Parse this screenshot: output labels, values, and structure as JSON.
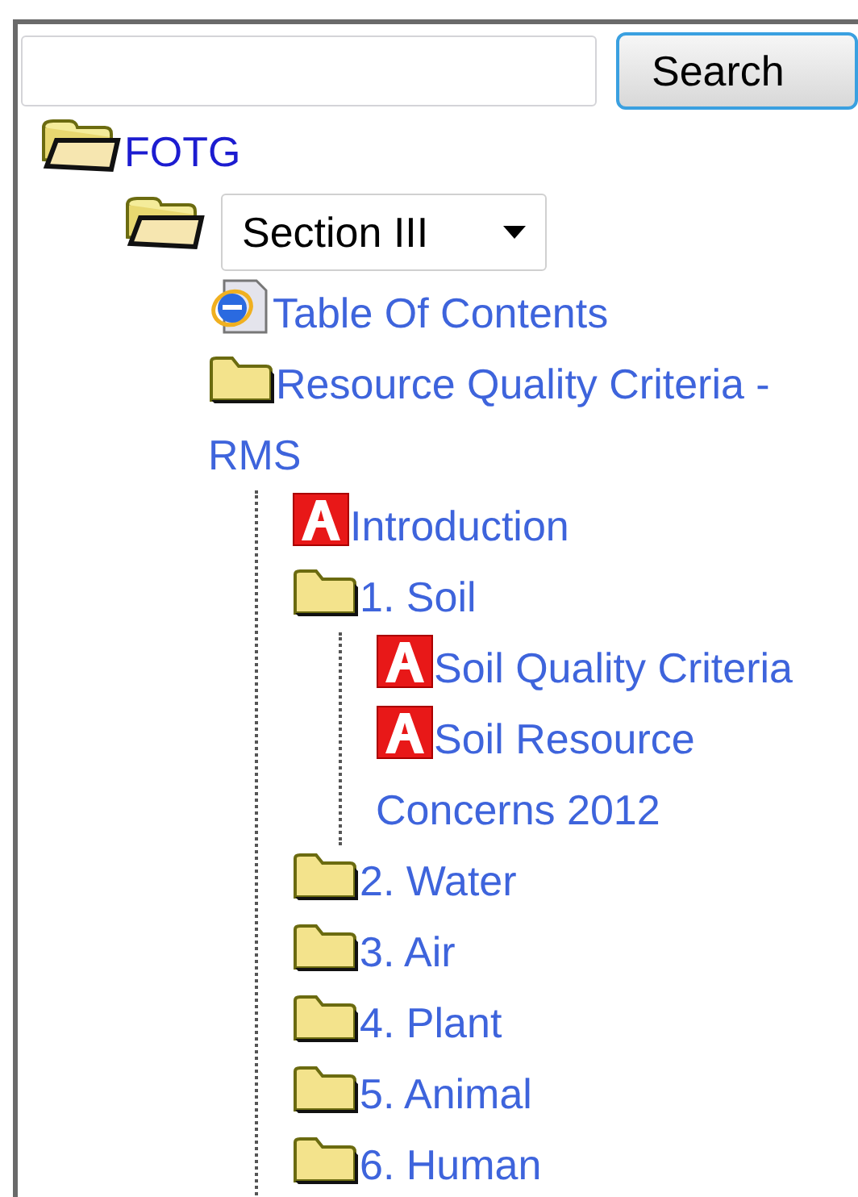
{
  "search": {
    "button": "Search"
  },
  "tree": [
    {
      "kind": "folder",
      "label": "FOTG",
      "expanded": true,
      "children": [
        {
          "kind": "select",
          "value": "Section III",
          "expanded": true,
          "children": [
            {
              "kind": "page",
              "label": "Table Of Contents"
            },
            {
              "kind": "folder",
              "label": "Resource Quality Criteria - RMS",
              "expanded": false,
              "children": [
                {
                  "kind": "pdf",
                  "label": "Introduction"
                },
                {
                  "kind": "folder",
                  "label": "1. Soil",
                  "expanded": false,
                  "children": [
                    {
                      "kind": "pdf",
                      "label": "Soil Quality Criteria"
                    },
                    {
                      "kind": "pdf",
                      "label": "Soil Resource Concerns 2012"
                    }
                  ]
                },
                {
                  "kind": "folder",
                  "label": "2. Water",
                  "expanded": false
                },
                {
                  "kind": "folder",
                  "label": "3. Air",
                  "expanded": false
                },
                {
                  "kind": "folder",
                  "label": "4. Plant",
                  "expanded": false
                },
                {
                  "kind": "folder",
                  "label": "5. Animal",
                  "expanded": false
                },
                {
                  "kind": "folder",
                  "label": "6. Human",
                  "expanded": false
                }
              ]
            }
          ]
        }
      ]
    }
  ]
}
